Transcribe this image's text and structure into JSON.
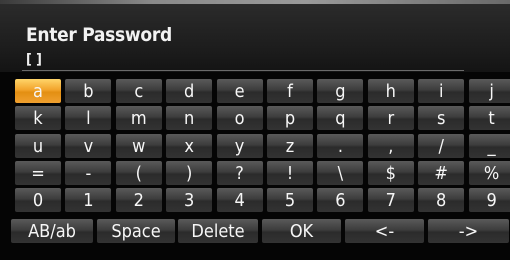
{
  "title": "Enter Password",
  "input": {
    "value": "[ ]"
  },
  "keyboard": {
    "rows": [
      [
        "a",
        "b",
        "c",
        "d",
        "e",
        "f",
        "g",
        "h",
        "i",
        "j"
      ],
      [
        "k",
        "l",
        "m",
        "n",
        "o",
        "p",
        "q",
        "r",
        "s",
        "t"
      ],
      [
        "u",
        "v",
        "w",
        "x",
        "y",
        "z",
        ".",
        ",",
        "/",
        "_"
      ],
      [
        "=",
        "-",
        "(",
        ")",
        "?",
        "!",
        "\\",
        "$",
        "#",
        "%"
      ],
      [
        "0",
        "1",
        "2",
        "3",
        "4",
        "5",
        "6",
        "7",
        "8",
        "9"
      ]
    ],
    "function_keys": [
      "AB/ab",
      "Space",
      "Delete",
      "OK",
      "<-",
      "->"
    ],
    "selected_key": "a"
  },
  "colors": {
    "selected_key": "#f2a42c",
    "key_background": "#3d3d3d",
    "background": "#000000"
  }
}
